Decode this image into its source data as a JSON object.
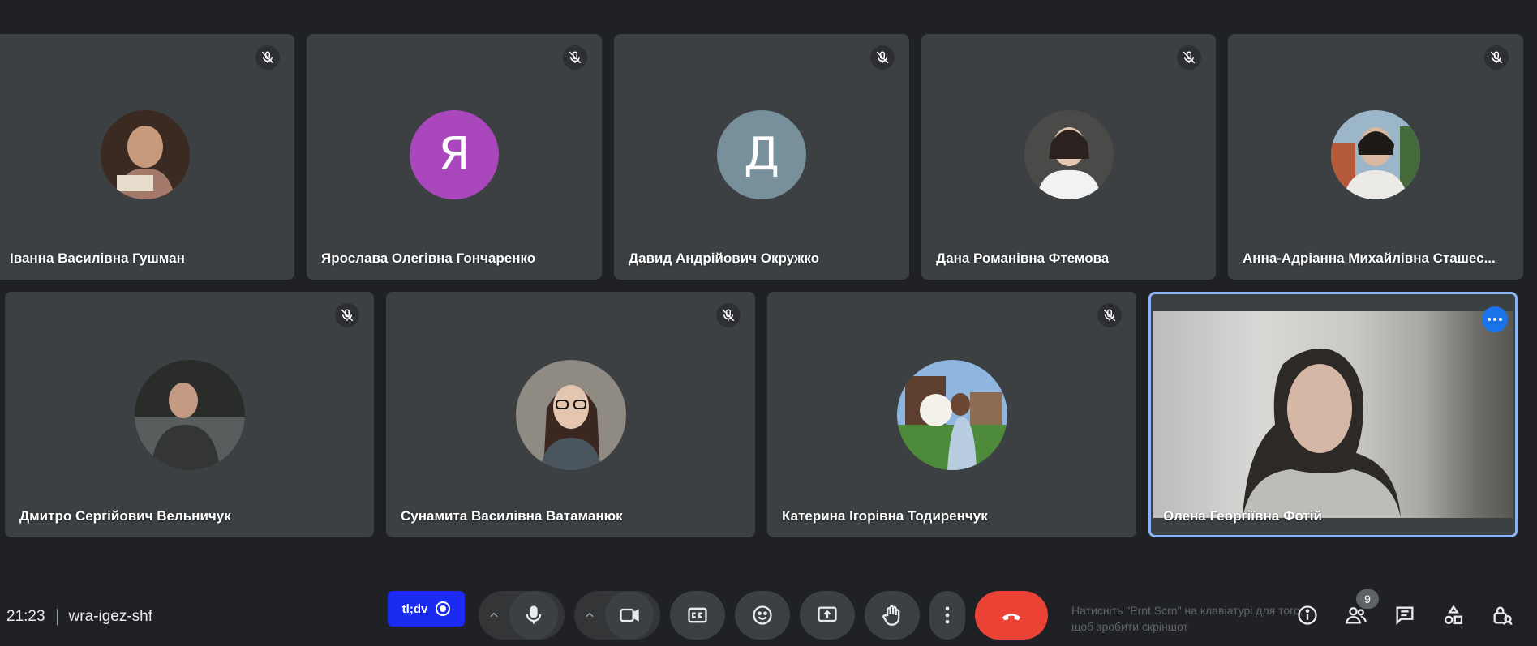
{
  "participants_row1": [
    {
      "name": "Іванна Василівна Гушман",
      "avatar": "photo-avatar"
    },
    {
      "name": "Ярослава Олегівна Гончаренко",
      "initial": "Я",
      "avatar_color": "#ab47bc"
    },
    {
      "name": "Давид Андрійович Окружко",
      "initial": "Д",
      "avatar_color": "#78909c"
    },
    {
      "name": "Дана Романівна Фтемова",
      "avatar": "photo-avatar"
    },
    {
      "name": "Анна-Адріанна Михайлівна Сташес...",
      "avatar": "photo-avatar"
    }
  ],
  "participants_row2": [
    {
      "name": "Дмитро Сергійович Вельничук",
      "avatar": "photo-avatar"
    },
    {
      "name": "Сунамита Василівна Ватаманюк",
      "avatar": "photo-avatar"
    },
    {
      "name": "Катерина Ігорівна Тодиренчук",
      "avatar": "photo-avatar"
    },
    {
      "name": "Олена Георгіївна Фотій",
      "video": true
    }
  ],
  "meeting": {
    "time": "21:23",
    "code": "wra-igez-shf"
  },
  "tldv": {
    "label": "tl;dv"
  },
  "screenshot_hint": "Натисніть \"Prnt Scrn\" на клавіатурі для того, щоб зробити скріншот",
  "people_count": "9",
  "colors": {
    "background": "#202124",
    "tile": "#3c4043",
    "leave": "#ea4335",
    "accent": "#8ab4f8",
    "tldv": "#1c2bf2"
  }
}
